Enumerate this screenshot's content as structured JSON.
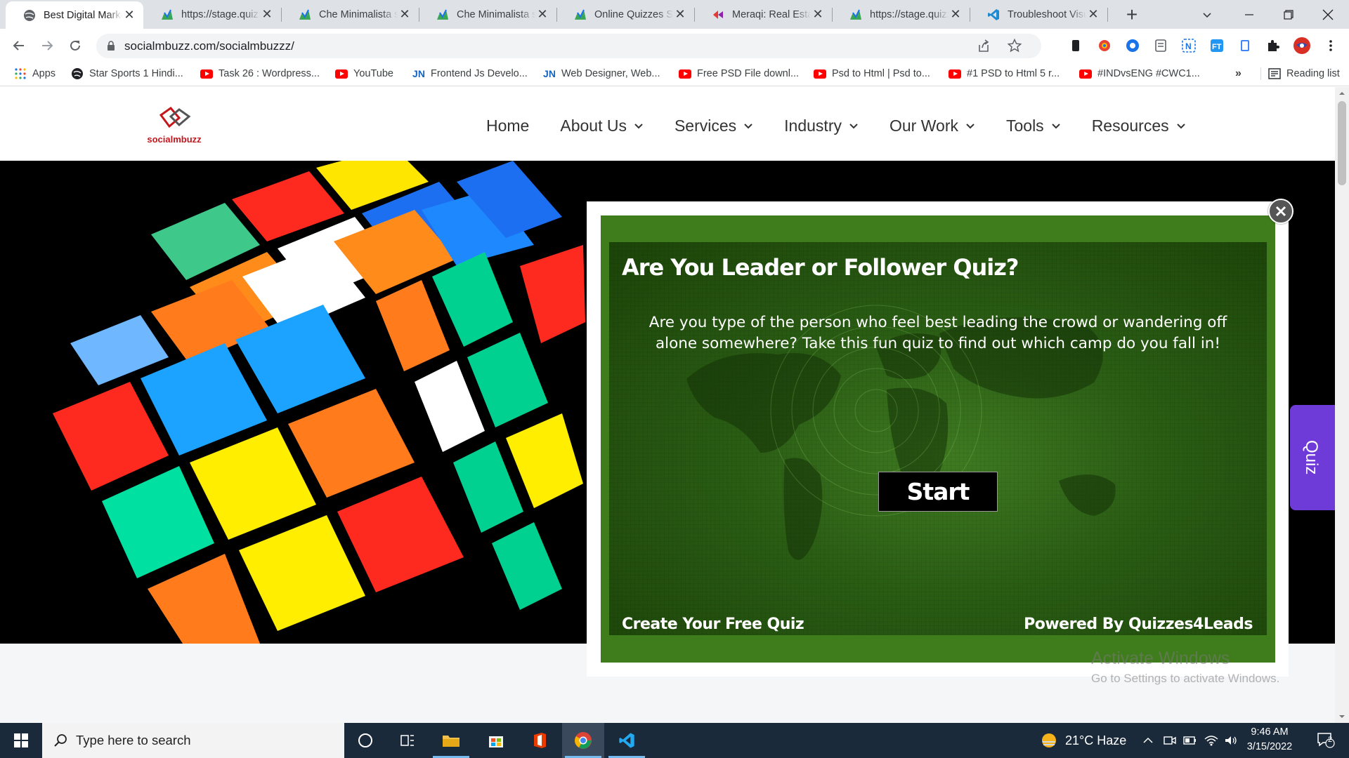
{
  "browser": {
    "tabs": [
      {
        "title": "Best Digital Marketing",
        "favicon": "globe-icon",
        "active": true
      },
      {
        "title": "https://stage.quizzes",
        "favicon": "chart-favicon-icon"
      },
      {
        "title": "Che Minimalista siete",
        "favicon": "chart-favicon-icon"
      },
      {
        "title": "Che Minimalista siete",
        "favicon": "chart-favicon-icon"
      },
      {
        "title": "Online Quizzes Software",
        "favicon": "chart-favicon-icon"
      },
      {
        "title": "Meraqi: Real Estate",
        "favicon": "meraqi-icon"
      },
      {
        "title": "https://stage.quizzes",
        "favicon": "chart-favicon-icon"
      },
      {
        "title": "Troubleshoot Visual",
        "favicon": "vscode-icon"
      }
    ],
    "url": "socialmbuzz.com/socialmbuzzz/",
    "bookmarks": [
      {
        "label": "Apps",
        "icon": "apps-grid-icon"
      },
      {
        "label": "Star Sports 1 Hindi...",
        "icon": "globe-icon"
      },
      {
        "label": "Task 26 : Wordpress...",
        "icon": "youtube-icon"
      },
      {
        "label": "YouTube",
        "icon": "youtube-icon"
      },
      {
        "label": "Frontend Js Develo...",
        "icon": "jn-icon"
      },
      {
        "label": "Web Designer, Web...",
        "icon": "jn-icon"
      },
      {
        "label": "Free PSD File downl...",
        "icon": "youtube-icon"
      },
      {
        "label": "Psd to Html | Psd to...",
        "icon": "youtube-icon"
      },
      {
        "label": "#1 PSD to Html 5 r...",
        "icon": "youtube-icon"
      },
      {
        "label": "#INDvsENG #CWC1...",
        "icon": "youtube-icon"
      }
    ],
    "more_bookmarks": "»",
    "reading_list": "Reading list"
  },
  "site": {
    "logo_text": "socialmbuzz",
    "nav": [
      {
        "label": "Home",
        "dropdown": false
      },
      {
        "label": "About Us",
        "dropdown": true
      },
      {
        "label": "Services",
        "dropdown": true
      },
      {
        "label": "Industry",
        "dropdown": true
      },
      {
        "label": "Our Work",
        "dropdown": true
      },
      {
        "label": "Tools",
        "dropdown": true
      },
      {
        "label": "Resources",
        "dropdown": true
      }
    ],
    "quiz_tab": "Quiz"
  },
  "quiz": {
    "title": "Are You Leader or Follower Quiz?",
    "description": "Are you type of the person who feel best leading the crowd or wandering off alone somewhere? Take this fun quiz to find out which camp do you fall in!",
    "start_label": "Start",
    "create_label": "Create Your Free Quiz",
    "powered_label": "Powered By Quizzes4Leads"
  },
  "watermark": {
    "title": "Activate Windows",
    "subtitle": "Go to Settings to activate Windows."
  },
  "taskbar": {
    "search_placeholder": "Type here to search",
    "weather": "21°C  Haze",
    "time": "9:46 AM",
    "date": "3/15/2022",
    "notification_count": "2"
  },
  "colors": {
    "quiz_green": "#3f7d1c",
    "quiz_tab_purple": "#6e3bd9",
    "logo_red": "#c4161c",
    "taskbar": "#1b2a3a"
  }
}
